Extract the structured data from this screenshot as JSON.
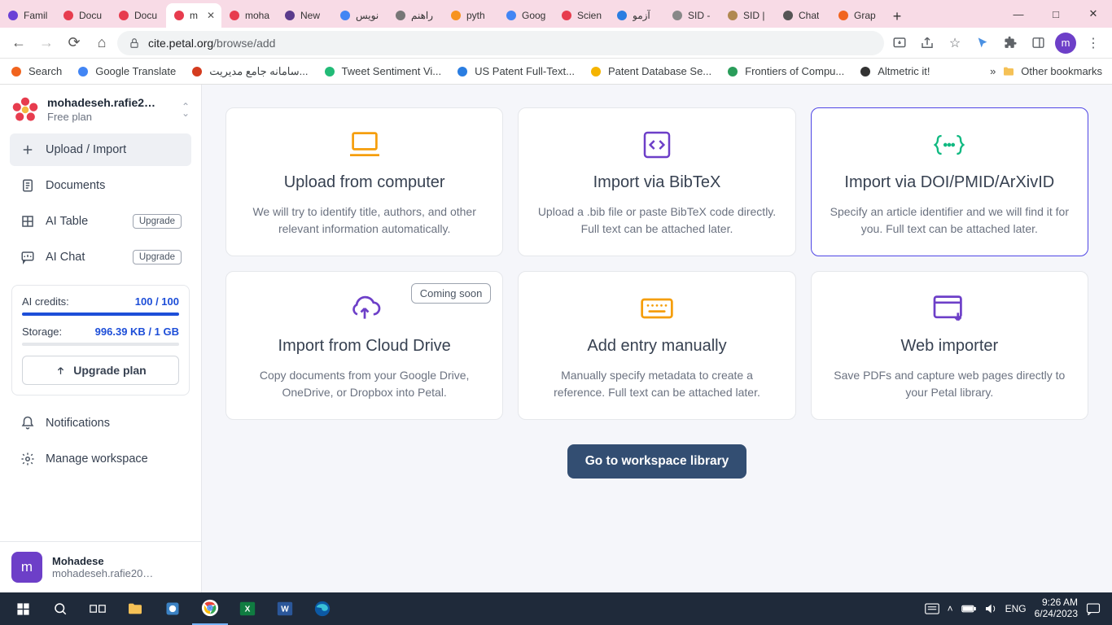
{
  "browser": {
    "tabs": [
      {
        "label": "Famil",
        "color": "#6a41d6"
      },
      {
        "label": "Docu",
        "color": "#e73c4e"
      },
      {
        "label": "Docu",
        "color": "#e73c4e"
      },
      {
        "label": "m",
        "color": "#e73c4e",
        "active": true
      },
      {
        "label": "moha",
        "color": "#e73c4e"
      },
      {
        "label": "New",
        "color": "#5b3b8c"
      },
      {
        "label": "نویس",
        "color": "#4285f4"
      },
      {
        "label": "راهنم",
        "color": "#777"
      },
      {
        "label": "pyth",
        "color": "#f7931e"
      },
      {
        "label": "Goog",
        "color": "#4285f4"
      },
      {
        "label": "Scien",
        "color": "#e73c4e"
      },
      {
        "label": "آزمو",
        "color": "#2a7de1"
      },
      {
        "label": "SID -",
        "color": "#888"
      },
      {
        "label": "SID |",
        "color": "#b08850"
      },
      {
        "label": "Chat",
        "color": "#555"
      },
      {
        "label": "Grap",
        "color": "#f1641e"
      }
    ],
    "url_host": "cite.petal.org",
    "url_path": "/browse/add",
    "avatar_letter": "m"
  },
  "bookmarks": [
    {
      "label": "Search",
      "color": "#f1641e"
    },
    {
      "label": "Google Translate",
      "color": "#4285f4"
    },
    {
      "label": "سامانه جامع مدیریت...",
      "color": "#d43c1f"
    },
    {
      "label": "Tweet Sentiment Vi...",
      "color": "#2b7"
    },
    {
      "label": "US Patent Full-Text...",
      "color": "#2a7de1"
    },
    {
      "label": "Patent Database Se...",
      "color": "#f5b400"
    },
    {
      "label": "Frontiers of Compu...",
      "color": "#2a9d5a"
    },
    {
      "label": "Altmetric it!",
      "color": "#333"
    }
  ],
  "bookmarks_more": "»",
  "bookmarks_other": "Other bookmarks",
  "sidebar": {
    "workspace_name": "mohadeseh.rafie2…",
    "workspace_plan": "Free plan",
    "items": [
      {
        "label": "Upload / Import",
        "icon": "plus",
        "active": true
      },
      {
        "label": "Documents",
        "icon": "docs"
      },
      {
        "label": "AI Table",
        "icon": "table",
        "badge": "Upgrade"
      },
      {
        "label": "AI Chat",
        "icon": "chat",
        "badge": "Upgrade"
      }
    ],
    "credits_label": "AI credits:",
    "credits_value": "100 / 100",
    "storage_label": "Storage:",
    "storage_value": "996.39 KB / 1 GB",
    "upgrade_btn": "Upgrade plan",
    "bottom_items": [
      {
        "label": "Notifications",
        "icon": "bell"
      },
      {
        "label": "Manage workspace",
        "icon": "gear"
      }
    ],
    "user_name": "Mohadese",
    "user_email": "mohadeseh.rafie20…",
    "user_letter": "m"
  },
  "cards": [
    {
      "icon": "laptop",
      "title": "Upload from computer",
      "desc": "We will try to identify title, authors, and other relevant information automatically.",
      "color": "#f59e0b"
    },
    {
      "icon": "code",
      "title": "Import via BibTeX",
      "desc": "Upload a .bib file or paste BibTeX code directly. Full text can be attached later.",
      "color": "#6d3fc8"
    },
    {
      "icon": "braces",
      "title": "Import via DOI/PMID/ArXivID",
      "desc": "Specify an article identifier and we will find it for you. Full text can be attached later.",
      "color": "#10b981",
      "selected": true
    },
    {
      "icon": "cloud",
      "title": "Import from Cloud Drive",
      "desc": "Copy documents from your Google Drive, OneDrive, or Dropbox into Petal.",
      "color": "#6d3fc8",
      "badge": "Coming soon"
    },
    {
      "icon": "keyboard",
      "title": "Add entry manually",
      "desc": "Manually specify metadata to create a reference. Full text can be attached later.",
      "color": "#f59e0b"
    },
    {
      "icon": "browser",
      "title": "Web importer",
      "desc": "Save PDFs and capture web pages directly to your Petal library.",
      "color": "#6d3fc8"
    }
  ],
  "go_button": "Go to workspace library",
  "taskbar": {
    "lang": "ENG",
    "time": "9:26 AM",
    "date": "6/24/2023"
  }
}
